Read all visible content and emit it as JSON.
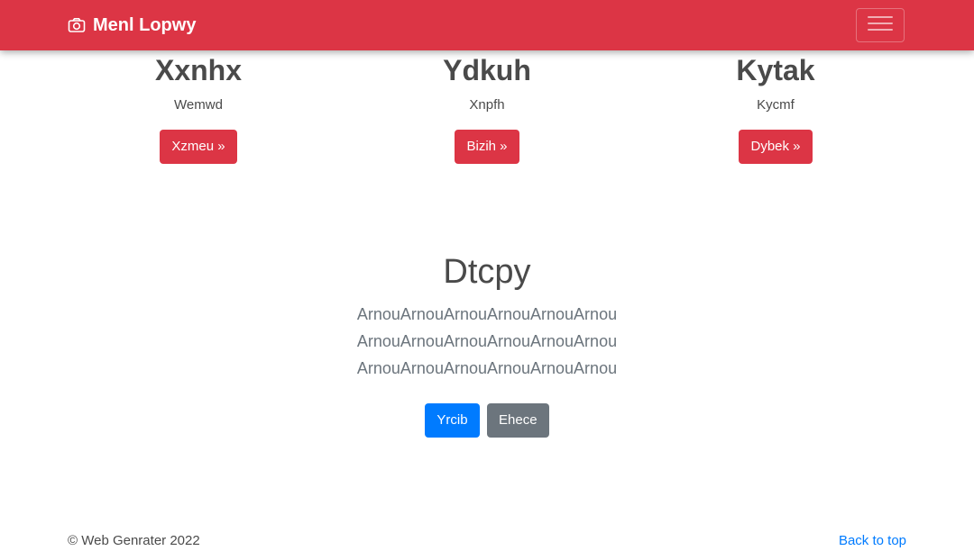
{
  "navbar": {
    "brand": "Menl Lopwy",
    "brand_icon": "camera-icon",
    "toggler_icon": "hamburger-menu-icon",
    "background": "#dc3545"
  },
  "columns": [
    {
      "title": "Xxnhx",
      "text": "Wemwd",
      "button": "Xzmeu »"
    },
    {
      "title": "Ydkuh",
      "text": "Xnpfh",
      "button": "Bizih »"
    },
    {
      "title": "Kytak",
      "text": "Kycmf",
      "button": "Dybek »"
    }
  ],
  "hero": {
    "title": "Dtcpy",
    "lead": "ArnouArnouArnouArnouArnouArnou ArnouArnouArnouArnouArnouArnou ArnouArnouArnouArnouArnouArnou",
    "primary_button": "Yrcib",
    "secondary_button": "Ehece"
  },
  "footer": {
    "copyright": "© Web Genrater 2022",
    "back_to_top": "Back to top"
  },
  "colors": {
    "danger": "#dc3545",
    "primary": "#007bff",
    "secondary": "#6c757d"
  }
}
